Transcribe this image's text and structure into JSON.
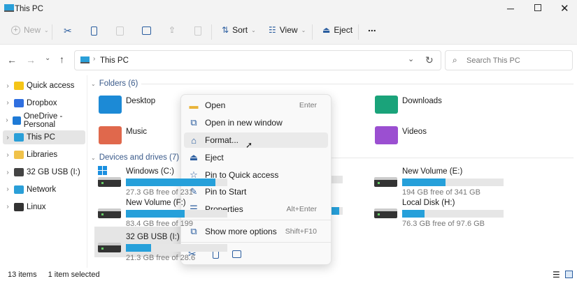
{
  "window": {
    "title": "This PC",
    "controls": [
      "minimize",
      "maximize",
      "close"
    ]
  },
  "toolbar": {
    "new": "New",
    "sort": "Sort",
    "view": "View",
    "eject": "Eject",
    "more": "..."
  },
  "nav": {
    "breadcrumb": "This PC",
    "search_placeholder": "Search This PC"
  },
  "sidebar": {
    "items": [
      {
        "label": "Quick access",
        "icon": "star-icon",
        "color": "#f5c518"
      },
      {
        "label": "Dropbox",
        "icon": "dropbox-icon",
        "color": "#2f6fe0"
      },
      {
        "label": "OneDrive - Personal",
        "icon": "cloud-icon",
        "color": "#1e7ad6"
      },
      {
        "label": "This PC",
        "icon": "computer-icon",
        "color": "#2a9fd8",
        "selected": true
      },
      {
        "label": "Libraries",
        "icon": "folder-icon",
        "color": "#f0c24a"
      },
      {
        "label": "32 GB USB (I:)",
        "icon": "usb-drive-icon",
        "color": "#444"
      },
      {
        "label": "Network",
        "icon": "network-icon",
        "color": "#2a9fd8"
      },
      {
        "label": "Linux",
        "icon": "linux-icon",
        "color": "#333"
      }
    ]
  },
  "folders": {
    "header": "Folders (6)",
    "items": [
      {
        "label": "Desktop",
        "color": "#1c8ad6"
      },
      {
        "label": "Music",
        "color": "#e0684c"
      },
      {
        "label": "Downloads",
        "color": "#1aa37a"
      },
      {
        "label": "Videos",
        "color": "#9b4fd1"
      }
    ]
  },
  "drives": {
    "header": "Devices and drives (7)",
    "items": [
      {
        "name": "Windows (C:)",
        "free": "27.3 GB free of 231",
        "used_pct": 88
      },
      {
        "name": "New Volume (F:)",
        "free": "83.4 GB free of 199",
        "used_pct": 58
      },
      {
        "name": "32 GB USB (I:)",
        "free": "21.3 GB free of 28.6",
        "used_pct": 25,
        "selected": true
      },
      {
        "name": "New Volume (E:)",
        "free": "194 GB free of 341 GB",
        "used_pct": 43
      },
      {
        "name": "Local Disk (H:)",
        "free": "76.3 GB free of 97.6 GB",
        "used_pct": 22
      }
    ]
  },
  "context_menu": {
    "items": [
      {
        "label": "Open",
        "shortcut": "Enter",
        "icon": "folder-open-icon"
      },
      {
        "label": "Open in new window",
        "shortcut": "",
        "icon": "open-new-window-icon"
      },
      {
        "label": "Format...",
        "shortcut": "",
        "icon": "format-icon",
        "hovered": true
      },
      {
        "label": "Eject",
        "shortcut": "",
        "icon": "eject-icon"
      },
      {
        "label": "Pin to Quick access",
        "shortcut": "",
        "icon": "star-icon"
      },
      {
        "label": "Pin to Start",
        "shortcut": "",
        "icon": "pin-icon"
      },
      {
        "label": "Properties",
        "shortcut": "Alt+Enter",
        "icon": "properties-icon"
      },
      {
        "label": "Show more options",
        "shortcut": "Shift+F10",
        "icon": "more-options-icon"
      }
    ]
  },
  "status": {
    "items": "13 items",
    "selected": "1 item selected"
  },
  "accent": "#26a0da"
}
